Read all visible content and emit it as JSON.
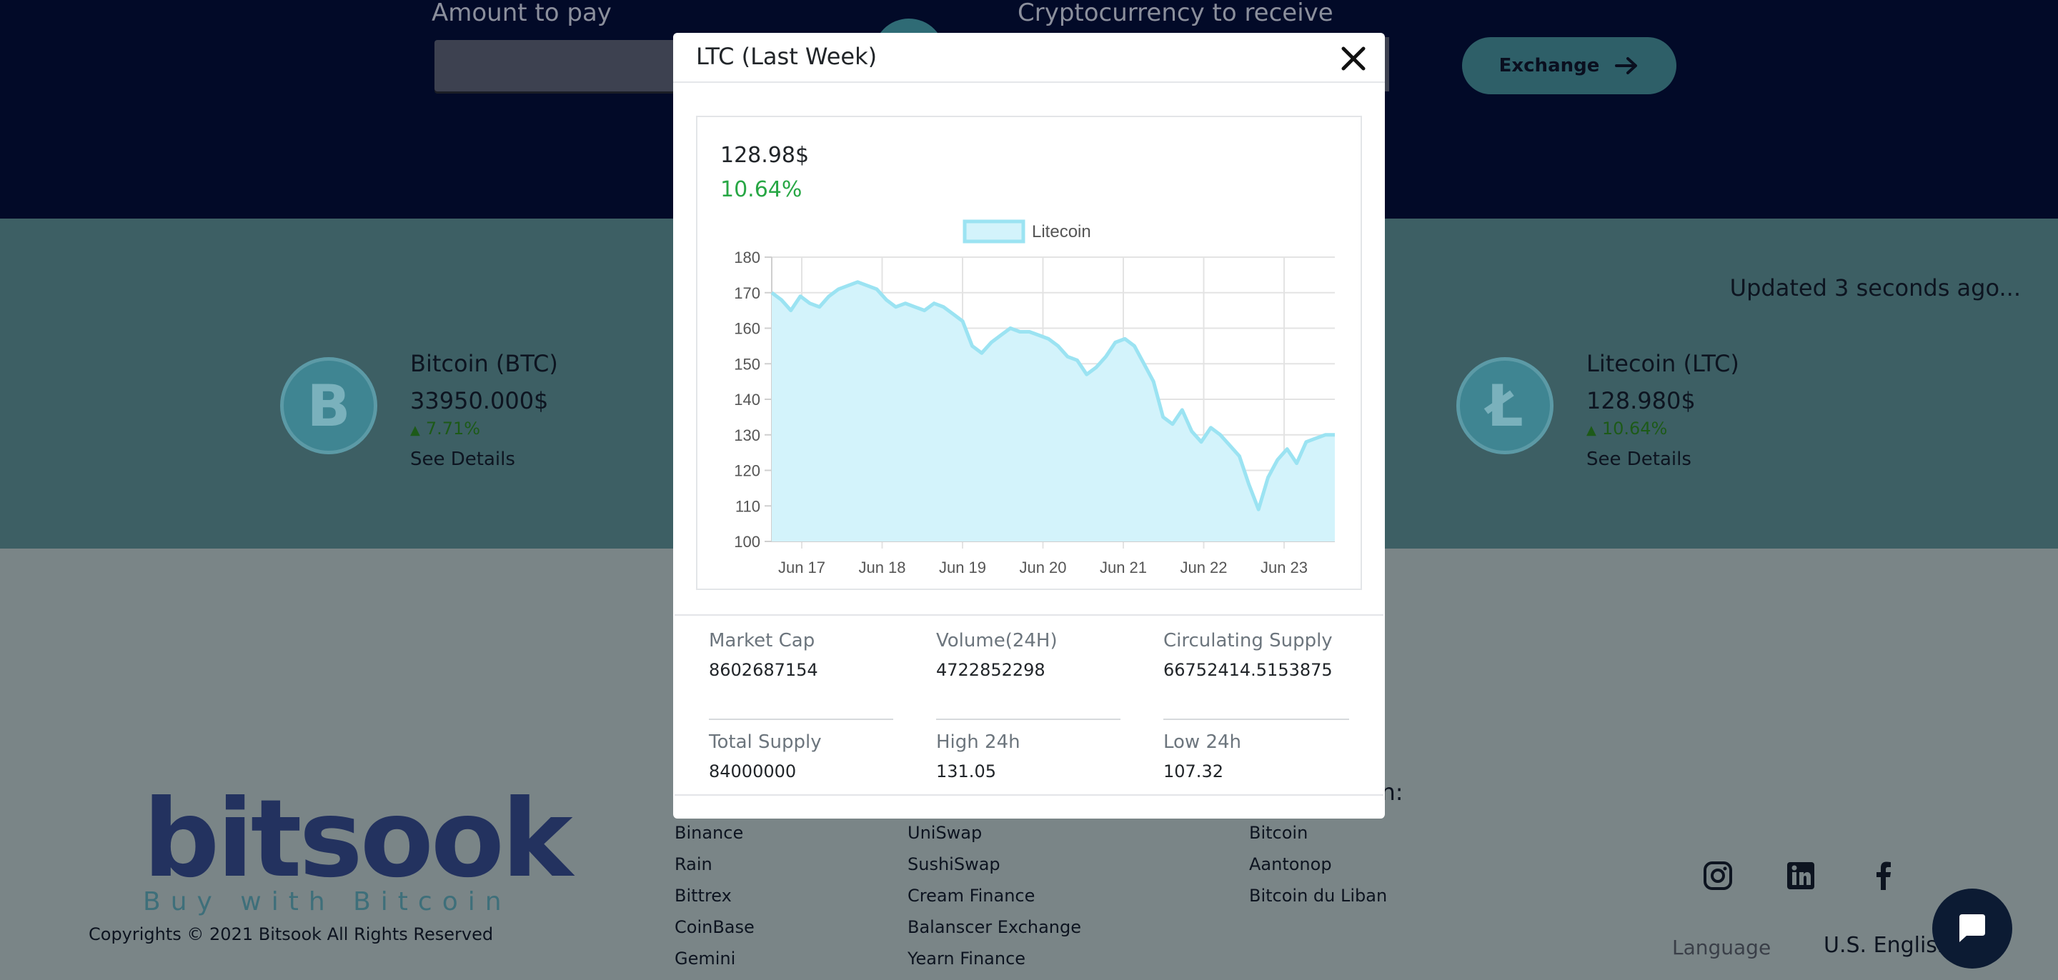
{
  "exchange_form": {
    "amount_label": "Amount to pay",
    "crypto_label": "Cryptocurrency to receive",
    "exchange_button": "Exchange"
  },
  "updated_text": "Updated 3 seconds ago...",
  "coins": [
    {
      "name": "Bitcoin (BTC)",
      "price": "33950.000$",
      "change": "7.71%",
      "details": "See Details",
      "symbol": "bitcoin-icon"
    },
    {
      "name": "Litecoin (LTC)",
      "price": "128.980$",
      "change": "10.64%",
      "details": "See Details",
      "symbol": "litecoin-icon"
    }
  ],
  "modal": {
    "title": "LTC (Last Week)",
    "price": "128.98$",
    "change": "10.64%",
    "stats": [
      {
        "label": "Market Cap",
        "value": "8602687154"
      },
      {
        "label": "Volume(24H)",
        "value": "4722852298"
      },
      {
        "label": "Circulating Supply",
        "value": "66752414.5153875"
      },
      {
        "label": "Total Supply",
        "value": "84000000"
      },
      {
        "label": "High 24h",
        "value": "131.05"
      },
      {
        "label": "Low 24h",
        "value": "107.32"
      }
    ]
  },
  "chart_data": {
    "type": "area",
    "series": [
      {
        "name": "Litecoin",
        "values": [
          170,
          168,
          165,
          169,
          167,
          166,
          169,
          171,
          172,
          173,
          172,
          171,
          168,
          166,
          167,
          166,
          165,
          167,
          166,
          164,
          162,
          155,
          153,
          156,
          158,
          160,
          159,
          159,
          158,
          157,
          155,
          152,
          151,
          147,
          149,
          152,
          156,
          157,
          155,
          150,
          145,
          135,
          133,
          137,
          131,
          128,
          132,
          130,
          127,
          124,
          116,
          109,
          118,
          123,
          126,
          122,
          128,
          129,
          130,
          130
        ],
        "color": "#9be3f2",
        "fill": "#d3f3fb"
      }
    ],
    "x_ticks": [
      "Jun 17",
      "Jun 18",
      "Jun 19",
      "Jun 20",
      "Jun 21",
      "Jun 22",
      "Jun 23"
    ],
    "ylim": [
      100,
      180
    ],
    "y_ticks": [
      "100",
      "110",
      "120",
      "130",
      "140",
      "150",
      "160",
      "170",
      "180"
    ],
    "grid": true,
    "legend": "top-center"
  },
  "footer": {
    "brand_word": "bitsook",
    "brand_tagline": "Buy with Bitcoin",
    "copyright": "Copyrights © 2021 Bitsook All Rights Reserved",
    "col3_title": "oin:",
    "col1": [
      "Binance",
      "Rain",
      "Bittrex",
      "CoinBase",
      "Gemini"
    ],
    "col2": [
      "UniSwap",
      "SushiSwap",
      "Cream Finance",
      "Balanscer Exchange",
      "Yearn Finance"
    ],
    "col3": [
      "Bitcoin",
      "Aantonop",
      "Bitcoin du Liban"
    ],
    "language_label": "Language",
    "language_value": "U.S. English"
  },
  "colors": {
    "accent": "#2e5f68",
    "navy": "#020a28",
    "positive": "#28a745"
  }
}
